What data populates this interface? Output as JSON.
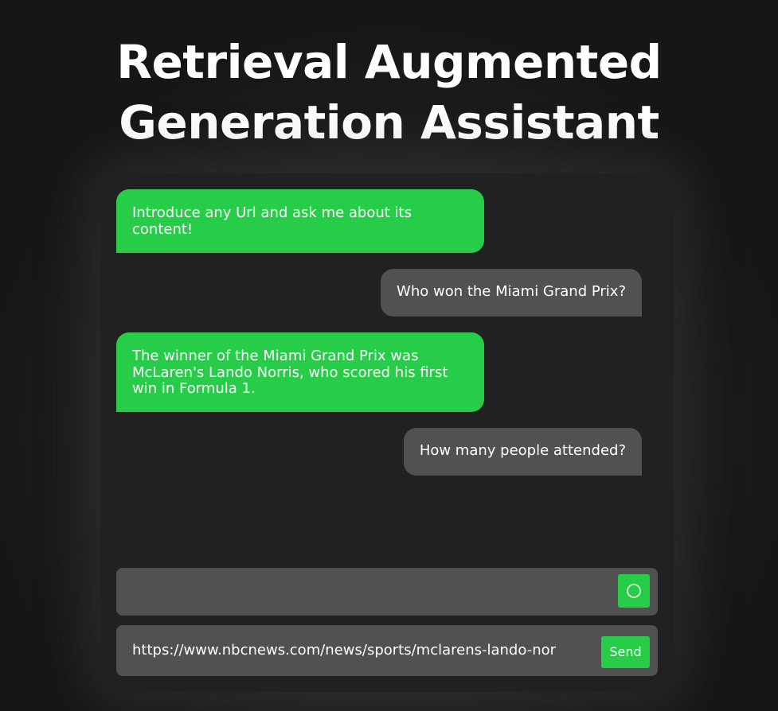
{
  "header": {
    "title_line1": "Retrieval Augmented",
    "title_line2": "Generation Assistant"
  },
  "chat": {
    "messages": [
      {
        "role": "assistant",
        "text": "Introduce any Url and ask me about its content!"
      },
      {
        "role": "user",
        "text": "Who won the Miami Grand Prix?"
      },
      {
        "role": "assistant",
        "text": "The winner of the Miami Grand Prix was McLaren's Lando Norris, who scored his first win in Formula 1."
      },
      {
        "role": "user",
        "text": "How many people attended?"
      }
    ]
  },
  "question_bar": {
    "value": "",
    "placeholder": "",
    "status_icon": "loading-spinner-icon"
  },
  "url_bar": {
    "value": "https://www.nbcnews.com/news/sports/mclarens-lando-nor",
    "send_label": "Send"
  },
  "colors": {
    "accent": "#27cd48",
    "bubble_user": "#515151",
    "panel": "#212121",
    "background": "#1c1c1c"
  }
}
